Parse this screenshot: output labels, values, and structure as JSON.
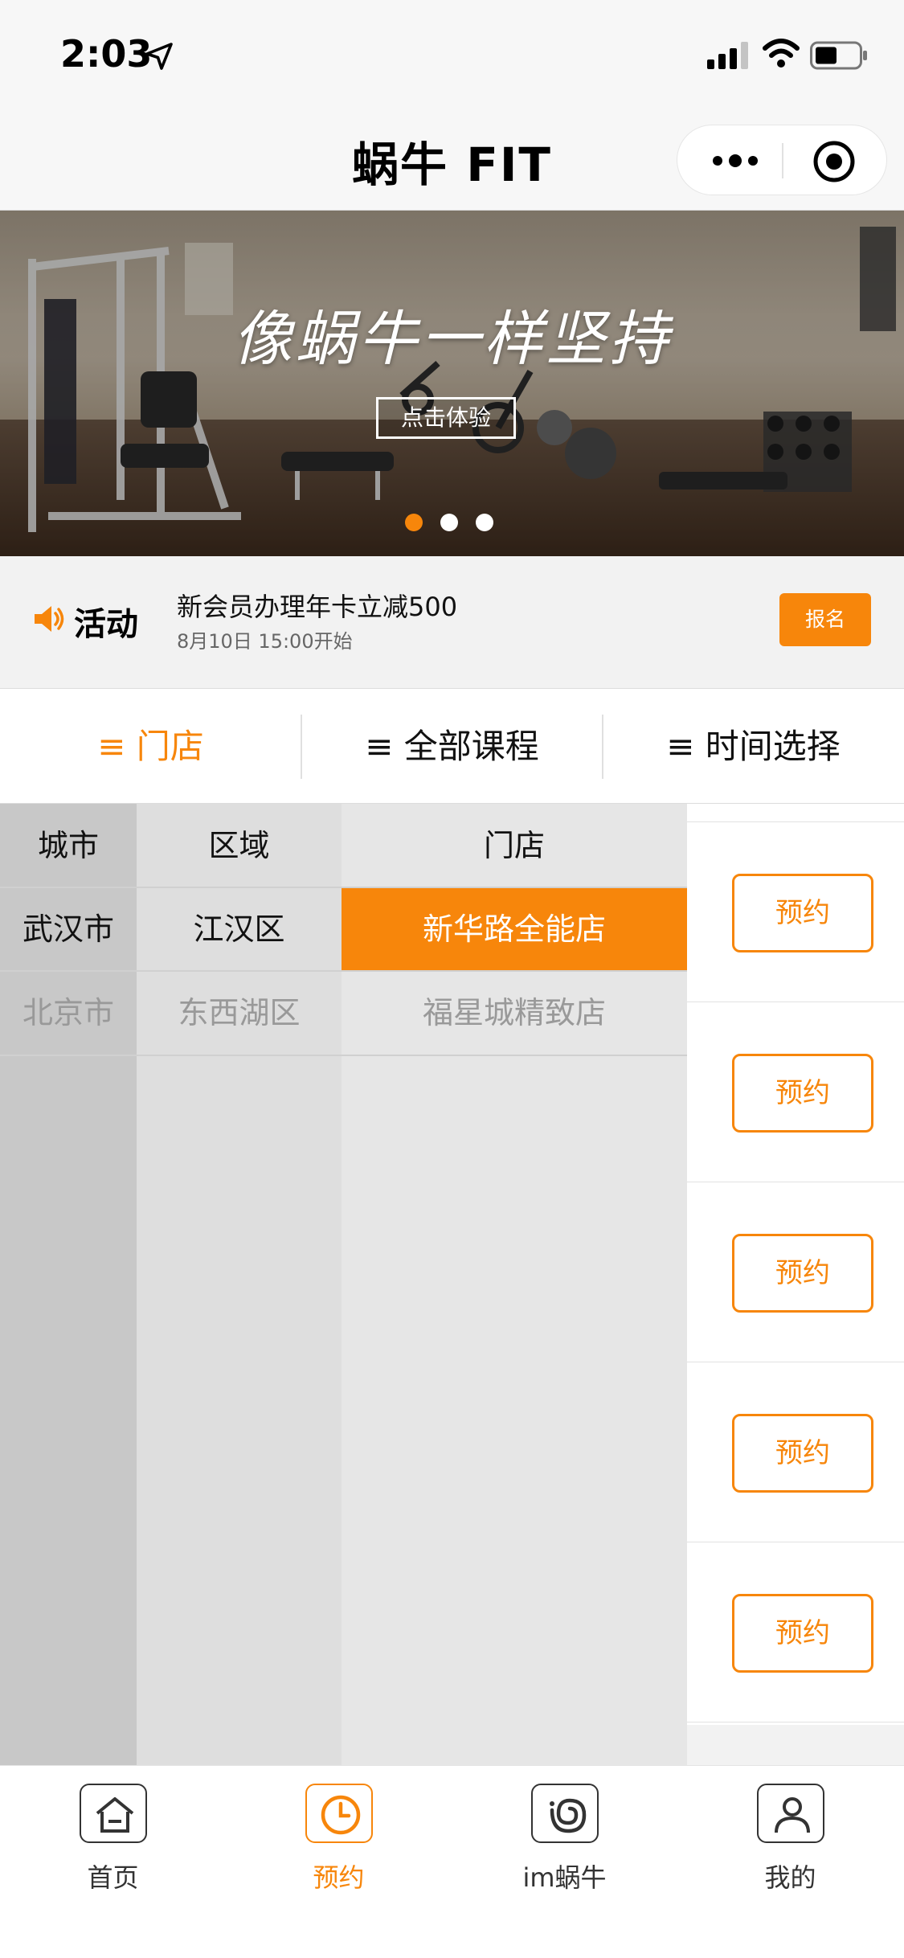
{
  "status_bar": {
    "time": "2:03"
  },
  "nav": {
    "title": "蜗牛 FIT"
  },
  "banner": {
    "slogan": "像蜗牛一样坚持",
    "cta_label": "点击体验",
    "active_dot": 0,
    "dot_count": 3
  },
  "activity": {
    "label": "活动",
    "title": "新会员办理年卡立减500",
    "time": "8月10日 15:00开始",
    "signup_label": "报名"
  },
  "filter_tabs": [
    {
      "label": "≡ 门店",
      "active": true
    },
    {
      "label": "≡ 全部课程",
      "active": false
    },
    {
      "label": "≡ 时间选择",
      "active": false
    }
  ],
  "dropdown": {
    "city": {
      "header": "城市",
      "items": [
        "武汉市",
        "北京市"
      ]
    },
    "area": {
      "header": "区域",
      "items": [
        "江汉区",
        "东西湖区"
      ]
    },
    "store": {
      "header": "门店",
      "items": [
        "新华路全能店",
        "福星城精致店"
      ],
      "selected_index": 0
    }
  },
  "book_buttons": [
    "预约",
    "预约",
    "预约",
    "预约",
    "预约"
  ],
  "tabbar": [
    {
      "label": "首页",
      "icon": "home-icon",
      "active": false
    },
    {
      "label": "预约",
      "icon": "clock-icon",
      "active": true
    },
    {
      "label": "im蜗牛",
      "icon": "snail-icon",
      "active": false
    },
    {
      "label": "我的",
      "icon": "person-icon",
      "active": false
    }
  ],
  "colors": {
    "accent": "#f7860b",
    "city_col": "#c8c8c8",
    "area_col": "#dedede",
    "store_col": "#e6e6e6"
  }
}
